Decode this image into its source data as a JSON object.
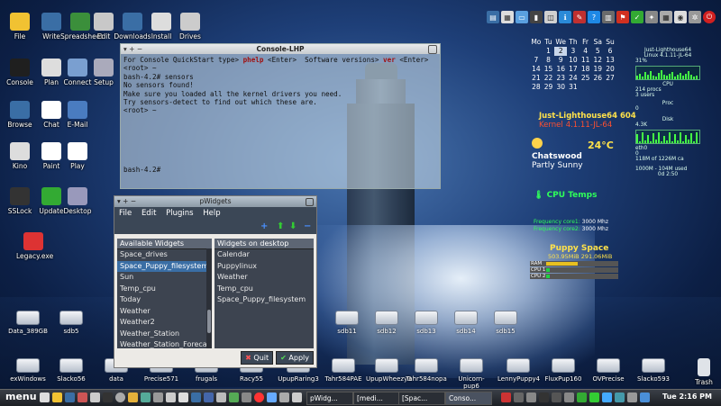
{
  "desktop": {
    "icons": [
      {
        "label": "File",
        "icon": "folder-icon"
      },
      {
        "label": "Write",
        "icon": "write-icon"
      },
      {
        "label": "Spreadsheet",
        "icon": "spreadsheet-icon"
      },
      {
        "label": "Edit",
        "icon": "edit-icon"
      },
      {
        "label": "Downloads",
        "icon": "downloads-icon"
      },
      {
        "label": "Install",
        "icon": "install-icon"
      },
      {
        "label": "Drives",
        "icon": "drives-icon"
      },
      {
        "label": "Console",
        "icon": "console-icon"
      },
      {
        "label": "Plan",
        "icon": "calendar-icon"
      },
      {
        "label": "Connect",
        "icon": "connect-icon"
      },
      {
        "label": "Setup",
        "icon": "setup-icon"
      },
      {
        "label": "Browse",
        "icon": "browse-icon"
      },
      {
        "label": "Chat",
        "icon": "chat-icon"
      },
      {
        "label": "E-Mail",
        "icon": "email-icon"
      },
      {
        "label": "Kino",
        "icon": "kino-icon"
      },
      {
        "label": "Paint",
        "icon": "paint-icon"
      },
      {
        "label": "Play",
        "icon": "play-icon"
      },
      {
        "label": "SSLock",
        "icon": "lock-icon"
      },
      {
        "label": "Update",
        "icon": "update-icon"
      },
      {
        "label": "Desktop",
        "icon": "desktop-icon"
      },
      {
        "label": "Legacy.exe",
        "icon": "legacy-icon"
      }
    ],
    "drives_row1": [
      "Data_389GB",
      "sdb5",
      "sdb11",
      "sdb12",
      "sdb13",
      "sdb14",
      "sdb15"
    ],
    "drives_row2": [
      "exWindows",
      "Slacko56",
      "data",
      "Precise571",
      "frugals",
      "Racy55",
      "UpupRaring3",
      "Tahr584PAE",
      "UpupWheezy3",
      "Tahr584nopa",
      "Unicorn-pup6",
      "LennyPuppy4",
      "FluxPup160",
      "OVPrecise",
      "Slacko593"
    ],
    "trash": "Trash"
  },
  "console": {
    "title": "Console-LHP",
    "line1_a": "For Console QuickStart type> ",
    "line1_k1": "phelp",
    "line1_b": " <Enter>  Software versions> ",
    "line1_k2": "ver",
    "line1_c": " <Enter>",
    "lines": [
      "<root> ~",
      "bash-4.2# sensors",
      "No sensors found!",
      "Make sure you loaded all the kernel drivers you need.",
      "Try sensors-detect to find out which these are.",
      "<root> ~"
    ],
    "prompt": "bash-4.2#"
  },
  "pwidgets": {
    "title": "pWidgets",
    "menus": [
      "File",
      "Edit",
      "Plugins",
      "Help"
    ],
    "available_header": "Available Widgets",
    "available": [
      "Space_drives",
      "Space_Puppy_filesystem",
      "Sun",
      "Temp_cpu",
      "Today",
      "Weather",
      "Weather2",
      "Weather_Station",
      "Weather_Station_Forecast"
    ],
    "selected_index": 1,
    "desktop_header": "Widgets on desktop",
    "on_desktop": [
      "Calendar",
      "Puppylinux",
      "Weather",
      "Temp_cpu",
      "Space_Puppy_filesystem"
    ],
    "quit": "Quit",
    "apply": "Apply"
  },
  "calendar": {
    "days": [
      "Mo",
      "Tu",
      "We",
      "Th",
      "Fr",
      "Sa",
      "Su"
    ],
    "dates": [
      "",
      "1",
      "2",
      "3",
      "4",
      "5",
      "6",
      "7",
      "8",
      "9",
      "10",
      "11",
      "12",
      "13",
      "14",
      "15",
      "16",
      "17",
      "18",
      "19",
      "20",
      "21",
      "22",
      "23",
      "24",
      "25",
      "26",
      "27",
      "28",
      "29",
      "30",
      "31",
      "",
      "",
      "",
      ""
    ],
    "today": "2"
  },
  "sysinfo": {
    "name": "Just-Lighthouse64",
    "version": "604",
    "kernel_label": "Kernel",
    "kernel": "4.1.11-JL-64",
    "conky_host": "Just-Lighthouse64",
    "conky_kernel": "Linux 4.1.11-JL-64",
    "cpu_pct": "31%",
    "cpu_label": "CPU",
    "procs": "214 procs",
    "users": "3 users",
    "proc_label": "Proc",
    "proc_val": "0",
    "disk_label": "Disk",
    "disk_val": "4.3K",
    "net_label": "eth0",
    "mem": "118M of 1226M ca",
    "swap": "1000M - 104M used",
    "uptime": "0d 2:50",
    "zero": "0"
  },
  "weather": {
    "temp": "24°C",
    "city": "Chatswood",
    "condition": "Partly Sunny"
  },
  "cputemps": {
    "title": "CPU Temps",
    "freq1_label": "Frequency core1:",
    "freq1": "3000 Mhz",
    "freq2_label": "Frequency core2:",
    "freq2": "3000 Mhz"
  },
  "puppyspace": {
    "title": "Puppy Space",
    "used": "503.95MiB",
    "free": "291.06MiB",
    "bars": [
      {
        "label": "RAM",
        "level": 0.45,
        "color": "#e8c020"
      },
      {
        "label": "CPU 1",
        "level": 0.05,
        "color": "#20d040"
      },
      {
        "label": "CPU 2",
        "level": 0.05,
        "color": "#20d040"
      }
    ]
  },
  "taskbar": {
    "menu": "menu",
    "tasks": [
      "pWidg...",
      "[medi...",
      "[Spac...",
      "Conso..."
    ],
    "active_index": 3,
    "clock": "Tue 2:16 PM"
  }
}
